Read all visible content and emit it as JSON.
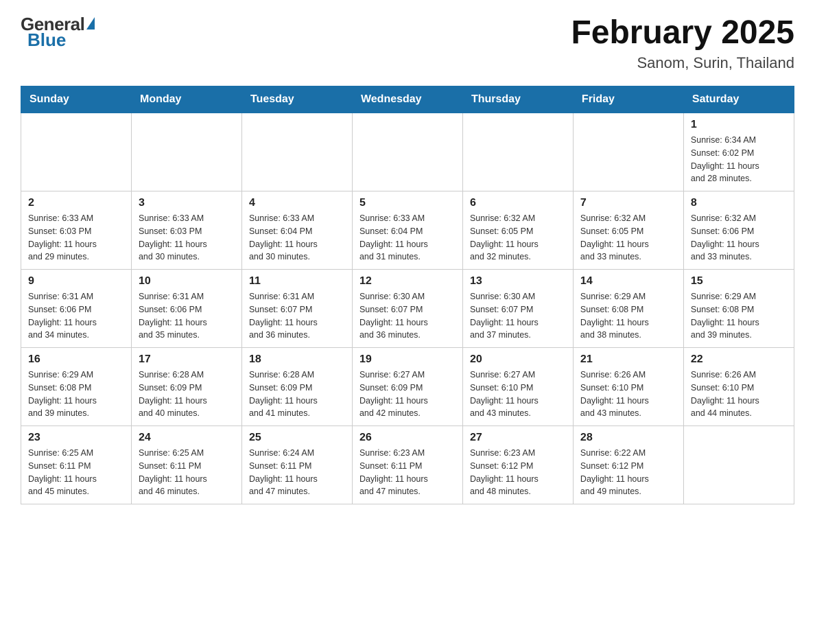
{
  "header": {
    "logo_general": "General",
    "logo_blue": "Blue",
    "month_title": "February 2025",
    "location": "Sanom, Surin, Thailand"
  },
  "days_of_week": [
    "Sunday",
    "Monday",
    "Tuesday",
    "Wednesday",
    "Thursday",
    "Friday",
    "Saturday"
  ],
  "weeks": [
    [
      {
        "day": "",
        "info": ""
      },
      {
        "day": "",
        "info": ""
      },
      {
        "day": "",
        "info": ""
      },
      {
        "day": "",
        "info": ""
      },
      {
        "day": "",
        "info": ""
      },
      {
        "day": "",
        "info": ""
      },
      {
        "day": "1",
        "info": "Sunrise: 6:34 AM\nSunset: 6:02 PM\nDaylight: 11 hours\nand 28 minutes."
      }
    ],
    [
      {
        "day": "2",
        "info": "Sunrise: 6:33 AM\nSunset: 6:03 PM\nDaylight: 11 hours\nand 29 minutes."
      },
      {
        "day": "3",
        "info": "Sunrise: 6:33 AM\nSunset: 6:03 PM\nDaylight: 11 hours\nand 30 minutes."
      },
      {
        "day": "4",
        "info": "Sunrise: 6:33 AM\nSunset: 6:04 PM\nDaylight: 11 hours\nand 30 minutes."
      },
      {
        "day": "5",
        "info": "Sunrise: 6:33 AM\nSunset: 6:04 PM\nDaylight: 11 hours\nand 31 minutes."
      },
      {
        "day": "6",
        "info": "Sunrise: 6:32 AM\nSunset: 6:05 PM\nDaylight: 11 hours\nand 32 minutes."
      },
      {
        "day": "7",
        "info": "Sunrise: 6:32 AM\nSunset: 6:05 PM\nDaylight: 11 hours\nand 33 minutes."
      },
      {
        "day": "8",
        "info": "Sunrise: 6:32 AM\nSunset: 6:06 PM\nDaylight: 11 hours\nand 33 minutes."
      }
    ],
    [
      {
        "day": "9",
        "info": "Sunrise: 6:31 AM\nSunset: 6:06 PM\nDaylight: 11 hours\nand 34 minutes."
      },
      {
        "day": "10",
        "info": "Sunrise: 6:31 AM\nSunset: 6:06 PM\nDaylight: 11 hours\nand 35 minutes."
      },
      {
        "day": "11",
        "info": "Sunrise: 6:31 AM\nSunset: 6:07 PM\nDaylight: 11 hours\nand 36 minutes."
      },
      {
        "day": "12",
        "info": "Sunrise: 6:30 AM\nSunset: 6:07 PM\nDaylight: 11 hours\nand 36 minutes."
      },
      {
        "day": "13",
        "info": "Sunrise: 6:30 AM\nSunset: 6:07 PM\nDaylight: 11 hours\nand 37 minutes."
      },
      {
        "day": "14",
        "info": "Sunrise: 6:29 AM\nSunset: 6:08 PM\nDaylight: 11 hours\nand 38 minutes."
      },
      {
        "day": "15",
        "info": "Sunrise: 6:29 AM\nSunset: 6:08 PM\nDaylight: 11 hours\nand 39 minutes."
      }
    ],
    [
      {
        "day": "16",
        "info": "Sunrise: 6:29 AM\nSunset: 6:08 PM\nDaylight: 11 hours\nand 39 minutes."
      },
      {
        "day": "17",
        "info": "Sunrise: 6:28 AM\nSunset: 6:09 PM\nDaylight: 11 hours\nand 40 minutes."
      },
      {
        "day": "18",
        "info": "Sunrise: 6:28 AM\nSunset: 6:09 PM\nDaylight: 11 hours\nand 41 minutes."
      },
      {
        "day": "19",
        "info": "Sunrise: 6:27 AM\nSunset: 6:09 PM\nDaylight: 11 hours\nand 42 minutes."
      },
      {
        "day": "20",
        "info": "Sunrise: 6:27 AM\nSunset: 6:10 PM\nDaylight: 11 hours\nand 43 minutes."
      },
      {
        "day": "21",
        "info": "Sunrise: 6:26 AM\nSunset: 6:10 PM\nDaylight: 11 hours\nand 43 minutes."
      },
      {
        "day": "22",
        "info": "Sunrise: 6:26 AM\nSunset: 6:10 PM\nDaylight: 11 hours\nand 44 minutes."
      }
    ],
    [
      {
        "day": "23",
        "info": "Sunrise: 6:25 AM\nSunset: 6:11 PM\nDaylight: 11 hours\nand 45 minutes."
      },
      {
        "day": "24",
        "info": "Sunrise: 6:25 AM\nSunset: 6:11 PM\nDaylight: 11 hours\nand 46 minutes."
      },
      {
        "day": "25",
        "info": "Sunrise: 6:24 AM\nSunset: 6:11 PM\nDaylight: 11 hours\nand 47 minutes."
      },
      {
        "day": "26",
        "info": "Sunrise: 6:23 AM\nSunset: 6:11 PM\nDaylight: 11 hours\nand 47 minutes."
      },
      {
        "day": "27",
        "info": "Sunrise: 6:23 AM\nSunset: 6:12 PM\nDaylight: 11 hours\nand 48 minutes."
      },
      {
        "day": "28",
        "info": "Sunrise: 6:22 AM\nSunset: 6:12 PM\nDaylight: 11 hours\nand 49 minutes."
      },
      {
        "day": "",
        "info": ""
      }
    ]
  ]
}
